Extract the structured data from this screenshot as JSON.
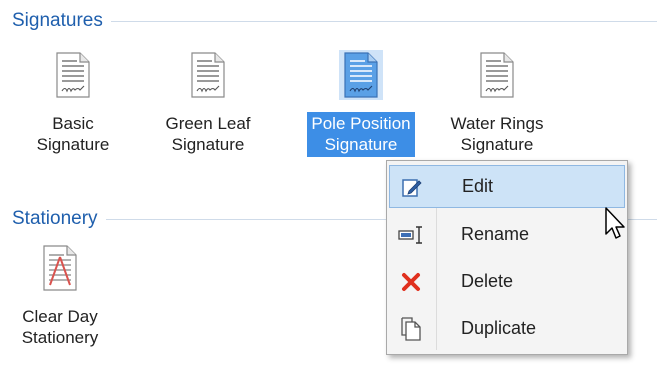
{
  "sections": {
    "signatures_title": "Signatures",
    "stationery_title": "Stationery"
  },
  "signatures": [
    {
      "label_line1": "Basic",
      "label_line2": "Signature",
      "icon": "signature-document-icon",
      "selected": false
    },
    {
      "label_line1": "Green Leaf",
      "label_line2": "Signature",
      "icon": "signature-document-icon",
      "selected": false
    },
    {
      "label_line1": "Pole Position",
      "label_line2": "Signature",
      "icon": "signature-document-icon",
      "selected": true
    },
    {
      "label_line1": "Water Rings",
      "label_line2": "Signature",
      "icon": "signature-document-icon",
      "selected": false
    }
  ],
  "stationery": [
    {
      "label_line1": "Clear Day",
      "label_line2": "Stationery",
      "icon": "stationery-document-icon"
    }
  ],
  "context_menu": {
    "items": [
      {
        "label": "Edit",
        "icon": "edit-pencil-icon",
        "highlighted": true
      },
      {
        "label": "Rename",
        "icon": "rename-icon",
        "highlighted": false
      },
      {
        "label": "Delete",
        "icon": "delete-x-icon",
        "highlighted": false
      },
      {
        "label": "Duplicate",
        "icon": "duplicate-icon",
        "highlighted": false
      }
    ]
  },
  "colors": {
    "section_title": "#1f5fad",
    "selection": "#3d8ee6",
    "menu_highlight": "#cde3f7",
    "delete_red": "#e0301e"
  }
}
